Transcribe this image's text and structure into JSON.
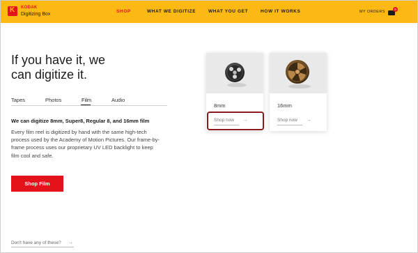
{
  "header": {
    "brand": "KODAK",
    "product": "Digitizing Box",
    "nav": [
      {
        "label": "SHOP",
        "active": true
      },
      {
        "label": "WHAT WE DIGITIZE",
        "active": false
      },
      {
        "label": "WHAT YOU GET",
        "active": false
      },
      {
        "label": "HOW IT WORKS",
        "active": false
      }
    ],
    "my_orders": "MY ORDERS",
    "cart_count": "0"
  },
  "hero": {
    "headline_line1": "If you have it, we",
    "headline_line2": "can digitize it."
  },
  "tabs": [
    {
      "label": "Tapes",
      "active": false
    },
    {
      "label": "Photos",
      "active": false
    },
    {
      "label": "Film",
      "active": true
    },
    {
      "label": "Audio",
      "active": false
    }
  ],
  "film": {
    "lead": "We can digitize 8mm, Super8, Regular 8, and 16mm film",
    "description": "Every film reel is digitized by hand with the same high-tech process used by the Academy of Motion Pictures. Our frame-by-frame process uses our proprietary UV LED backlight to keep film cool and safe.",
    "cta": "Shop Film"
  },
  "cards": [
    {
      "label": "8mm",
      "link": "Shop now",
      "arrow": "→",
      "icon": "film-reel-8mm-icon"
    },
    {
      "label": "16mm",
      "link": "Shop now",
      "arrow": "→",
      "icon": "film-reel-16mm-icon"
    }
  ],
  "footer": {
    "link": "Don't have any of these?",
    "arrow": "→"
  },
  "colors": {
    "header_bg": "#fdb913",
    "accent_red": "#e4131b",
    "highlight_border": "#8b1a1a"
  }
}
